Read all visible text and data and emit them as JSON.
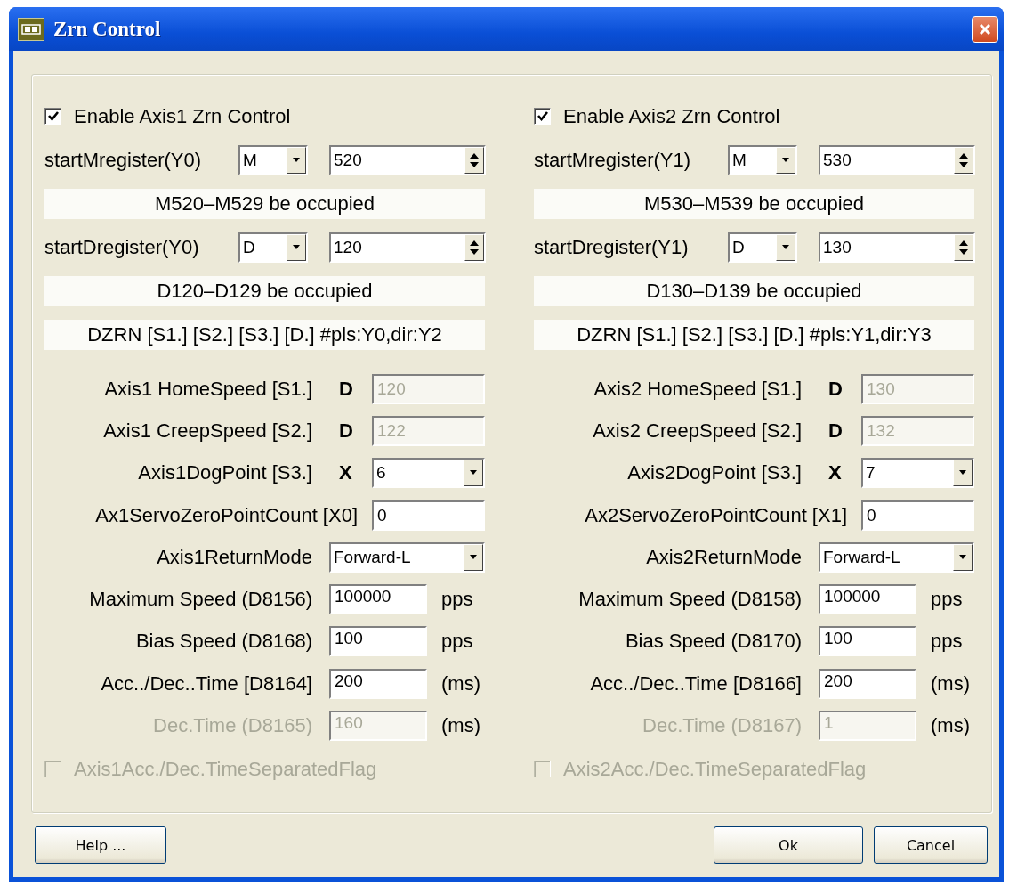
{
  "window": {
    "title": "Zrn Control"
  },
  "axes": [
    {
      "enable": {
        "label": "Enable Axis1 Zrn Control",
        "checked": true
      },
      "m_register": {
        "label": "startMregister(Y0)",
        "type": "M",
        "value": "520"
      },
      "m_note": "M520–M529 be occupied",
      "d_register": {
        "label": "startDregister(Y0)",
        "type": "D",
        "value": "120"
      },
      "d_note": "D120–D129 be occupied",
      "instruction": "DZRN [S1.] [S2.] [S3.] [D.] #pls:Y0,dir:Y2",
      "params": [
        {
          "kind": "device_field",
          "label": "Axis1 HomeSpeed [S1.]",
          "device": "D",
          "value": "120",
          "disabled": true
        },
        {
          "kind": "device_field",
          "label": "Axis1 CreepSpeed [S2.]",
          "device": "D",
          "value": "122",
          "disabled": true
        },
        {
          "kind": "device_combo",
          "label": "Axis1DogPoint [S3.]",
          "device": "X",
          "value": "6"
        },
        {
          "kind": "field",
          "label": "Ax1ServoZeroPointCount [X0]",
          "value": "0"
        },
        {
          "kind": "combo",
          "label": "Axis1ReturnMode",
          "value": "Forward-L"
        },
        {
          "kind": "unit_field",
          "label": "Maximum Speed (D8156)",
          "value": "100000",
          "unit": "pps",
          "disabled": false
        },
        {
          "kind": "unit_field",
          "label": "Bias Speed (D8168)",
          "value": "100",
          "unit": "pps",
          "disabled": false
        },
        {
          "kind": "unit_field",
          "label": "Acc../Dec..Time [D8164]",
          "value": "200",
          "unit": "(ms)",
          "disabled": false
        },
        {
          "kind": "unit_field",
          "label": "Dec.Time (D8165)",
          "value": "160",
          "unit": "(ms)",
          "disabled": true
        }
      ],
      "separated_flag": {
        "label": "Axis1Acc./Dec.TimeSeparatedFlag",
        "checked": false,
        "disabled": true
      }
    },
    {
      "enable": {
        "label": "Enable Axis2 Zrn Control",
        "checked": true
      },
      "m_register": {
        "label": "startMregister(Y1)",
        "type": "M",
        "value": "530"
      },
      "m_note": "M530–M539 be occupied",
      "d_register": {
        "label": "startDregister(Y1)",
        "type": "D",
        "value": "130"
      },
      "d_note": "D130–D139 be occupied",
      "instruction": "DZRN [S1.] [S2.] [S3.] [D.] #pls:Y1,dir:Y3",
      "params": [
        {
          "kind": "device_field",
          "label": "Axis2 HomeSpeed [S1.]",
          "device": "D",
          "value": "130",
          "disabled": true
        },
        {
          "kind": "device_field",
          "label": "Axis2 CreepSpeed [S2.]",
          "device": "D",
          "value": "132",
          "disabled": true
        },
        {
          "kind": "device_combo",
          "label": "Axis2DogPoint [S3.]",
          "device": "X",
          "value": "7"
        },
        {
          "kind": "field",
          "label": "Ax2ServoZeroPointCount [X1]",
          "value": "0"
        },
        {
          "kind": "combo",
          "label": "Axis2ReturnMode",
          "value": "Forward-L"
        },
        {
          "kind": "unit_field",
          "label": "Maximum Speed (D8158)",
          "value": "100000",
          "unit": "pps",
          "disabled": false
        },
        {
          "kind": "unit_field",
          "label": "Bias Speed (D8170)",
          "value": "100",
          "unit": "pps",
          "disabled": false
        },
        {
          "kind": "unit_field",
          "label": "Acc../Dec..Time [D8166]",
          "value": "200",
          "unit": "(ms)",
          "disabled": false
        },
        {
          "kind": "unit_field",
          "label": "Dec.Time (D8167)",
          "value": "1",
          "unit": "(ms)",
          "disabled": true
        }
      ],
      "separated_flag": {
        "label": "Axis2Acc./Dec.TimeSeparatedFlag",
        "checked": false,
        "disabled": true
      }
    }
  ],
  "buttons": {
    "help": "Help ...",
    "ok": "Ok",
    "cancel": "Cancel"
  }
}
